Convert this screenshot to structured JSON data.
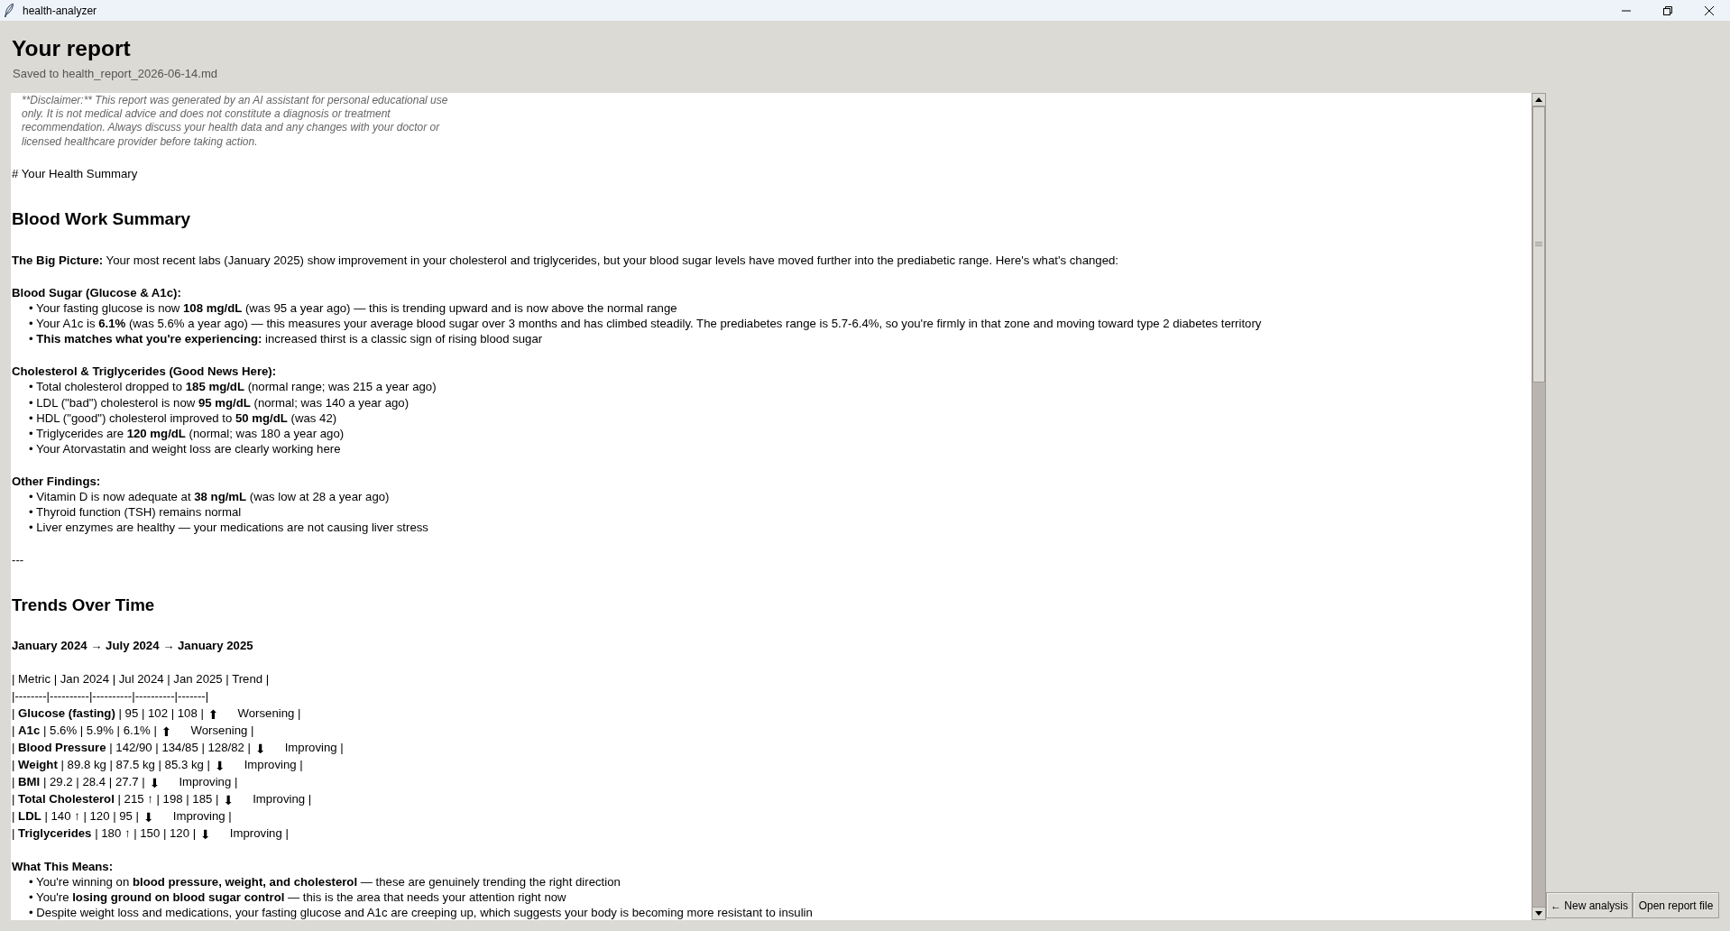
{
  "window": {
    "title": "health-analyzer"
  },
  "header": {
    "title": "Your report",
    "subtitle": "Saved to health_report_2026-06-14.md"
  },
  "report": {
    "blocks": [
      {
        "kind": "disclaimer",
        "text": "**Disclaimer:** This report was generated by an AI assistant for personal educational use only. It is not medical advice and does not constitute a diagnosis or treatment recommendation. Always discuss your health data and any changes with your doctor or licensed healthcare provider before taking action."
      },
      {
        "kind": "raw",
        "text": "# Your Health Summary"
      },
      {
        "kind": "heading",
        "text": "Blood Work Summary"
      },
      {
        "kind": "paragraph",
        "text": "**The Big Picture:** Your most recent labs (January 2025) show improvement in your cholesterol and triglycerides, but your blood sugar levels have moved further into the prediabetic range. Here's what's changed:"
      },
      {
        "kind": "subheading",
        "text": "Blood Sugar (Glucose & A1c):"
      },
      {
        "kind": "bullet",
        "text": "• Your fasting glucose is now **108 mg/dL** (was 95 a year ago) — this is trending upward and is now above the normal range"
      },
      {
        "kind": "bullet",
        "text": "• Your A1c is **6.1%** (was 5.6% a year ago) — this measures your average blood sugar over 3 months and has climbed steadily. The prediabetes range is 5.7-6.4%, so you're firmly in that zone and moving toward type 2 diabetes territory"
      },
      {
        "kind": "bullet",
        "text": "• **This matches what you're experiencing:** increased thirst is a classic sign of rising blood sugar"
      },
      {
        "kind": "subheading",
        "text": "Cholesterol & Triglycerides (Good News Here):"
      },
      {
        "kind": "bullet",
        "text": "• Total cholesterol dropped to **185 mg/dL** (normal range; was 215 a year ago)"
      },
      {
        "kind": "bullet",
        "text": "• LDL (\"bad\") cholesterol is now **95 mg/dL** (normal; was 140 a year ago)"
      },
      {
        "kind": "bullet",
        "text": "• HDL (\"good\") cholesterol improved to **50 mg/dL** (was 42)"
      },
      {
        "kind": "bullet",
        "text": "• Triglycerides are **120 mg/dL** (normal; was 180 a year ago)"
      },
      {
        "kind": "bullet",
        "text": "• Your Atorvastatin and weight loss are clearly working here"
      },
      {
        "kind": "subheading",
        "text": "Other Findings:"
      },
      {
        "kind": "bullet",
        "text": "• Vitamin D is now adequate at **38 ng/mL** (was low at 28 a year ago)"
      },
      {
        "kind": "bullet",
        "text": "• Thyroid function (TSH) remains normal"
      },
      {
        "kind": "bullet",
        "text": "• Liver enzymes are healthy — your medications are not causing liver stress"
      },
      {
        "kind": "raw",
        "text": "---"
      },
      {
        "kind": "heading",
        "text": "Trends Over Time"
      },
      {
        "kind": "subheading",
        "text": "January 2024 → July 2024 → January 2025"
      },
      {
        "kind": "table_line",
        "text": "| Metric | Jan 2024 | Jul 2024 | Jan 2025 | Trend |"
      },
      {
        "kind": "table_line",
        "text": "|--------|----------|----------|----------|-------|"
      },
      {
        "kind": "table_row",
        "text": "| **Glucose (fasting)** | 95 | 102 | 108 |",
        "arrow": "⬆",
        "trend": "Worsening |"
      },
      {
        "kind": "table_row",
        "text": "| **A1c** | 5.6% | 5.9% | 6.1% |",
        "arrow": "⬆",
        "trend": "Worsening |"
      },
      {
        "kind": "table_row",
        "text": "| **Blood Pressure** | 142/90 | 134/85 | 128/82 |",
        "arrow": "⬇",
        "trend": "Improving |"
      },
      {
        "kind": "table_row",
        "text": "| **Weight** | 89.8 kg | 87.5 kg | 85.3 kg |",
        "arrow": "⬇",
        "trend": "Improving |"
      },
      {
        "kind": "table_row",
        "text": "| **BMI** | 29.2 | 28.4 | 27.7 |",
        "arrow": "⬇",
        "trend": "Improving |"
      },
      {
        "kind": "table_row",
        "text": "| **Total Cholesterol** | 215 ↑ | 198 | 185 |",
        "arrow": "⬇",
        "trend": "Improving |"
      },
      {
        "kind": "table_row",
        "text": "| **LDL** | 140 ↑ | 120 | 95 |",
        "arrow": "⬇",
        "trend": "Improving |"
      },
      {
        "kind": "table_row",
        "text": "| **Triglycerides** | 180 ↑ | 150 | 120 |",
        "arrow": "⬇",
        "trend": "Improving |"
      },
      {
        "kind": "subheading",
        "text": "What This Means:"
      },
      {
        "kind": "bullet",
        "text": "• You're winning on **blood pressure, weight, and cholesterol** — these are genuinely trending the right direction"
      },
      {
        "kind": "bullet",
        "text": "• You're **losing ground on blood sugar control** — this is the area that needs your attention right now"
      },
      {
        "kind": "bullet",
        "text": "• Despite weight loss and medications, your fasting glucose and A1c are creeping up, which suggests your body is becoming more resistant to insulin"
      }
    ]
  },
  "buttons": [
    {
      "label": "← New analysis"
    },
    {
      "label": "Open report file"
    }
  ]
}
